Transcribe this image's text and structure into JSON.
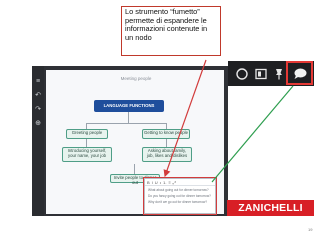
{
  "callout": {
    "text": "Lo strumento “fumetto” permette di espandere le informazioni contenute in un nodo"
  },
  "mindmap": {
    "title": "Meeting people",
    "main_node": "LANGUAGE FUNCTIONS",
    "nodes": [
      "Greeting people",
      "Getting to know people",
      "Introducing yourself, your name, your job",
      "Asking about family, job, likes and dislikes",
      "Invite people to dinner out"
    ]
  },
  "editor": {
    "toolbar_items": [
      "B",
      "I",
      "U",
      "•",
      "1.",
      "≡",
      "⤢"
    ],
    "lines": [
      "What about going out for dinner tomorrow?",
      "Do you fancy going out for dinner tomorrow?",
      "Why don't we go out for dinner tomorrow?"
    ]
  },
  "toolbar": {
    "icons": [
      "circle-icon",
      "book-icon",
      "pin-icon",
      "speech-bubble-icon"
    ]
  },
  "brand": {
    "name": "ZANICHELLI"
  },
  "page": {
    "number": "19"
  },
  "colors": {
    "highlight": "#e53935",
    "brand": "#d81f26",
    "main_node": "#1f4e9c"
  }
}
